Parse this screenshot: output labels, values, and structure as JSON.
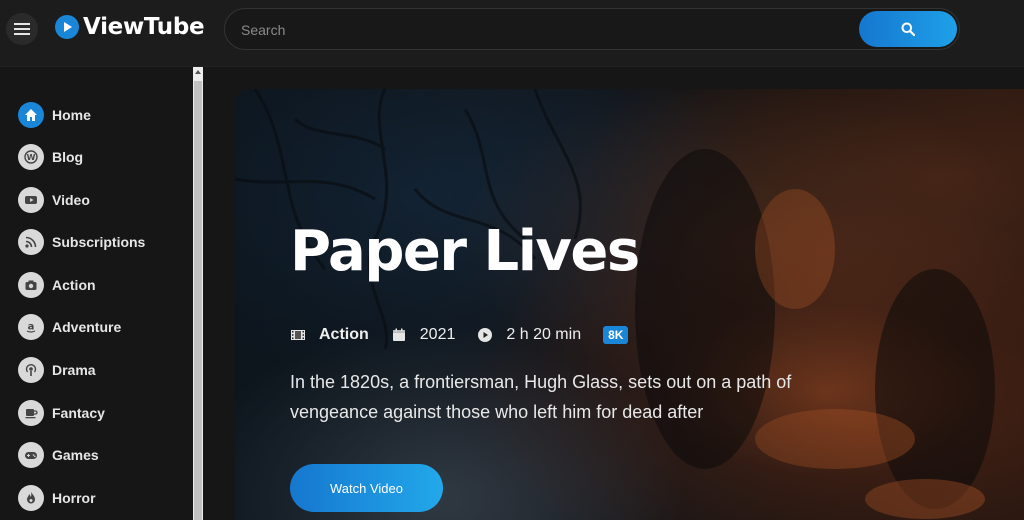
{
  "header": {
    "brand": "ViewTube",
    "search_placeholder": "Search"
  },
  "sidebar": {
    "items": [
      {
        "label": "Home",
        "icon": "home-icon",
        "active": true
      },
      {
        "label": "Blog",
        "icon": "wordpress-icon"
      },
      {
        "label": "Video",
        "icon": "youtube-icon"
      },
      {
        "label": "Subscriptions",
        "icon": "rss-icon"
      },
      {
        "label": "Action",
        "icon": "camera-icon"
      },
      {
        "label": "Adventure",
        "icon": "amazon-icon"
      },
      {
        "label": "Drama",
        "icon": "podcast-icon"
      },
      {
        "label": "Fantacy",
        "icon": "coffee-icon"
      },
      {
        "label": "Games",
        "icon": "gamepad-icon"
      },
      {
        "label": "Horror",
        "icon": "fire-icon"
      }
    ]
  },
  "hero": {
    "title": "Paper Lives",
    "genre": "Action",
    "year": "2021",
    "duration": "2 h 20 min",
    "quality": "8K",
    "description": "In the 1820s, a frontiersman, Hugh Glass, sets out on a path of vengeance against those who left him for dead after",
    "button_label": "Watch Video"
  },
  "colors": {
    "accent": "#1a86d8",
    "background": "#161616",
    "header": "#1c1c1c"
  }
}
